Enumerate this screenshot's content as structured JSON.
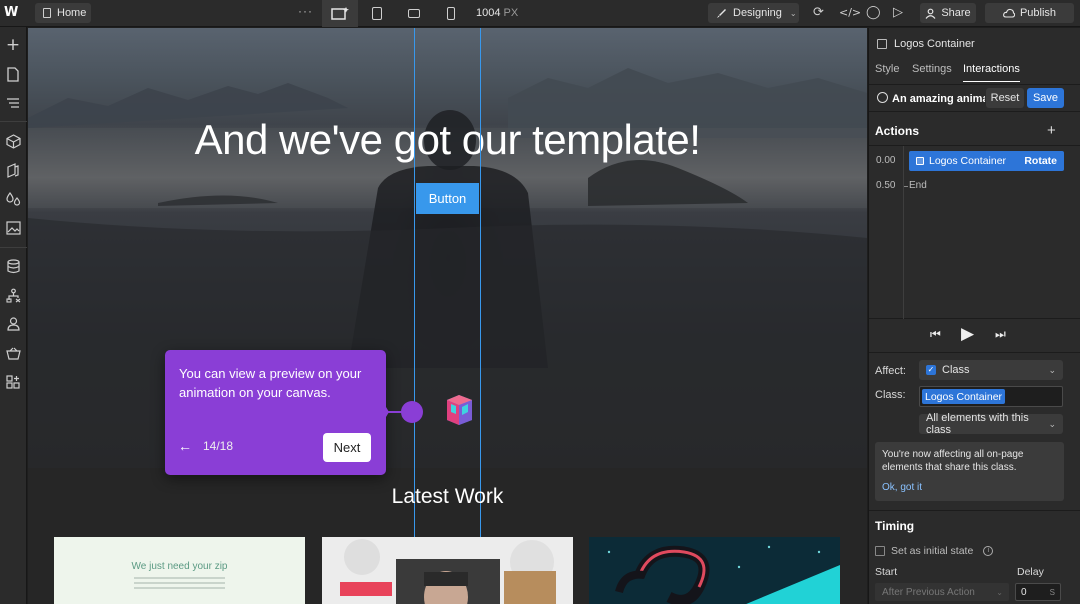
{
  "topbar": {
    "logo": "W",
    "home_tab": "Home",
    "more": "···",
    "width_value": "1004",
    "width_unit": "PX",
    "mode": "Designing",
    "share": "Share",
    "publish": "Publish"
  },
  "canvas": {
    "hero_title": "And we've got our template!",
    "hero_button": "Button",
    "latest_work": "Latest Work",
    "card1_text": "We just need your zip"
  },
  "tour": {
    "text": "You can view a preview on your animation on your canvas.",
    "back": "←",
    "count": "14/18",
    "next": "Next"
  },
  "panel": {
    "selected": "Logos Container",
    "tabs": [
      "Style",
      "Settings",
      "Interactions"
    ],
    "animation_name": "An amazing anima...",
    "reset": "Reset",
    "save": "Save",
    "actions_heading": "Actions",
    "add": "+",
    "timeline": {
      "t0": "0.00",
      "t1": "0.50",
      "action_target": "Logos Container",
      "action_verb": "Rotate",
      "end": "End"
    },
    "affect_label": "Affect:",
    "affect_value": "Class",
    "class_label": "Class:",
    "class_value": "Logos Container",
    "scope_value": "All elements with this class",
    "info_text": "You're now affecting all on-page elements that share this class.",
    "info_link": "Ok, got it",
    "timing_heading": "Timing",
    "initial_state": "Set as initial state",
    "start_label": "Start",
    "delay_label": "Delay",
    "start_value": "After Previous Action",
    "delay_value": "0",
    "delay_unit": "S"
  },
  "colors": {
    "accent": "#2d75d8",
    "tour": "#8a3ed6",
    "canvas_button": "#3898ec"
  }
}
